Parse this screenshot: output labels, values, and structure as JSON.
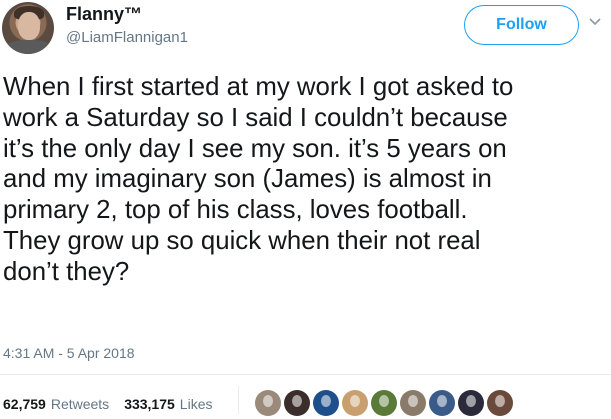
{
  "user": {
    "display_name": "Flanny™",
    "handle": "@LiamFlannigan1"
  },
  "follow_button": {
    "label": "Follow"
  },
  "tweet": {
    "lines": [
      "When I first started at my work I got asked to",
      "work a Saturday so I said I couldn’t because",
      "it’s the only day I see my son. it’s 5 years on",
      "and my imaginary son (James) is almost in",
      "primary 2, top of his class, loves football.",
      "They grow up so quick when their not real",
      "don’t they?"
    ],
    "timestamp": "4:31 AM - 5 Apr 2018"
  },
  "stats": {
    "retweets_count": "62,759",
    "retweets_label": "Retweets",
    "likes_count": "333,175",
    "likes_label": "Likes"
  },
  "likers": [
    {
      "color": "#9a8a7a"
    },
    {
      "color": "#3b2e2a"
    },
    {
      "color": "#1d4f8c"
    },
    {
      "color": "#c8a070"
    },
    {
      "color": "#5a7a3a"
    },
    {
      "color": "#8a7a6a"
    },
    {
      "color": "#3a5a8a"
    },
    {
      "color": "#2a2a3a"
    },
    {
      "color": "#6a4a3a"
    }
  ],
  "colors": {
    "accent": "#1da1f2",
    "secondary_text": "#657786",
    "primary_text": "#14171a"
  }
}
